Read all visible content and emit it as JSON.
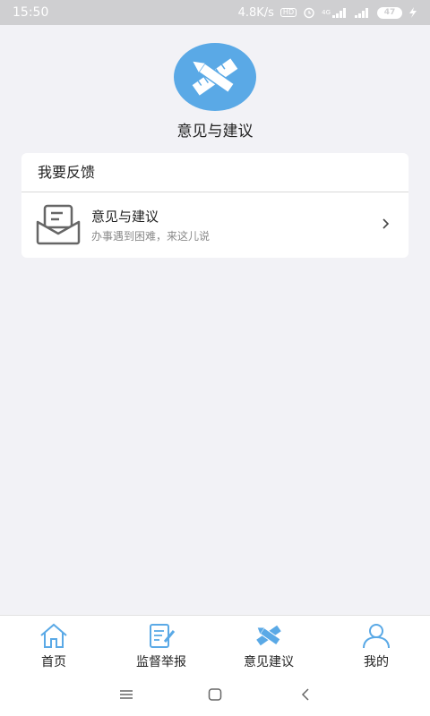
{
  "status_bar": {
    "time": "15:50",
    "speed": "4.8K/s",
    "hd": "HD",
    "network": "4G",
    "battery": "47"
  },
  "header": {
    "title": "意见与建议",
    "logo_color": "#5aa9e6"
  },
  "card": {
    "title": "我要反馈",
    "item": {
      "title": "意见与建议",
      "subtitle": "办事遇到困难，来这儿说"
    }
  },
  "tabs": [
    {
      "label": "首页",
      "icon": "home-icon"
    },
    {
      "label": "监督举报",
      "icon": "report-icon"
    },
    {
      "label": "意见建议",
      "icon": "pencil-ruler-icon",
      "active": true
    },
    {
      "label": "我的",
      "icon": "user-icon"
    }
  ],
  "colors": {
    "accent": "#5aa9e6",
    "background": "#f2f2f6",
    "status_bar": "#cfcfd1"
  }
}
